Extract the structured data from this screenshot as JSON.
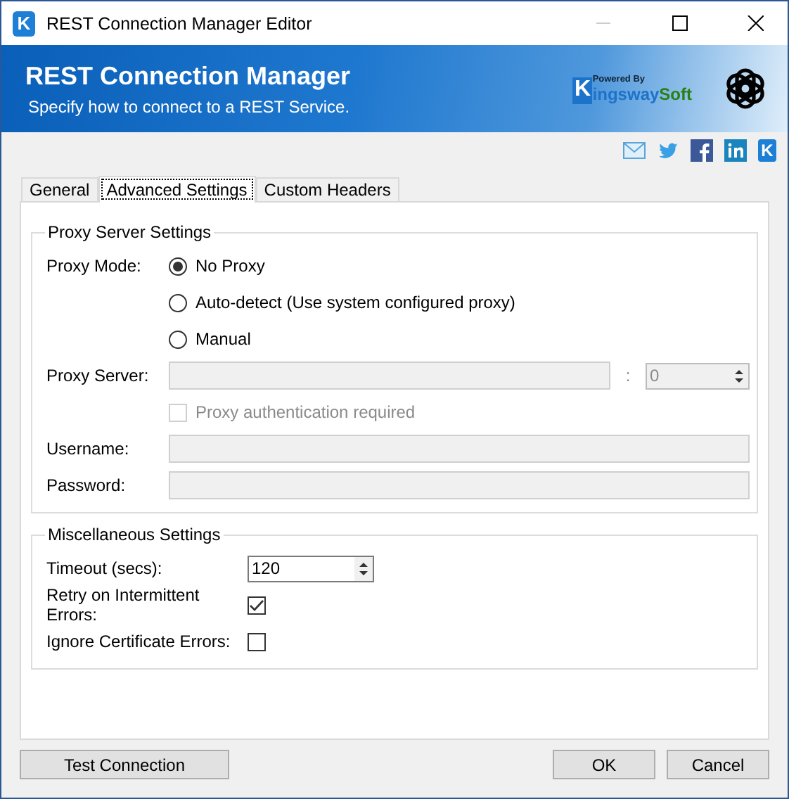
{
  "window": {
    "title": "REST Connection Manager Editor",
    "app_icon": "K"
  },
  "banner": {
    "title": "REST Connection Manager",
    "subtitle": "Specify how to connect to a REST Service.",
    "logo": {
      "powered_by": "Powered By",
      "initial": "K",
      "name": "ingsway",
      "suffix": "Soft"
    }
  },
  "social_links": [
    {
      "kind": "mail"
    },
    {
      "kind": "twitter"
    },
    {
      "kind": "facebook"
    },
    {
      "kind": "linkedin"
    },
    {
      "kind": "brand",
      "label": "K"
    }
  ],
  "tabs": [
    {
      "label": "General",
      "selected": false
    },
    {
      "label": "Advanced Settings",
      "selected": true
    },
    {
      "label": "Custom Headers",
      "selected": false
    }
  ],
  "proxy_group": {
    "title": "Proxy Server Settings",
    "mode_label": "Proxy Mode:",
    "modes": [
      {
        "label": "No Proxy",
        "selected": true
      },
      {
        "label": "Auto-detect (Use system configured proxy)",
        "selected": false
      },
      {
        "label": "Manual",
        "selected": false
      }
    ],
    "server_label": "Proxy Server:",
    "port_separator": ":",
    "port": "0",
    "fields_disabled": true,
    "auth": {
      "label": "Proxy authentication required",
      "checked": false,
      "disabled": true
    },
    "username_label": "Username:",
    "password_label": "Password:"
  },
  "misc_group": {
    "title": "Miscellaneous Settings",
    "timeout_label": "Timeout (secs):",
    "timeout": "120",
    "options": [
      {
        "label": "Retry on Intermittent Errors:",
        "checked": true
      },
      {
        "label": "Ignore Certificate Errors:",
        "checked": false
      }
    ]
  },
  "buttons": {
    "test": "Test Connection",
    "ok": "OK",
    "cancel": "Cancel"
  }
}
